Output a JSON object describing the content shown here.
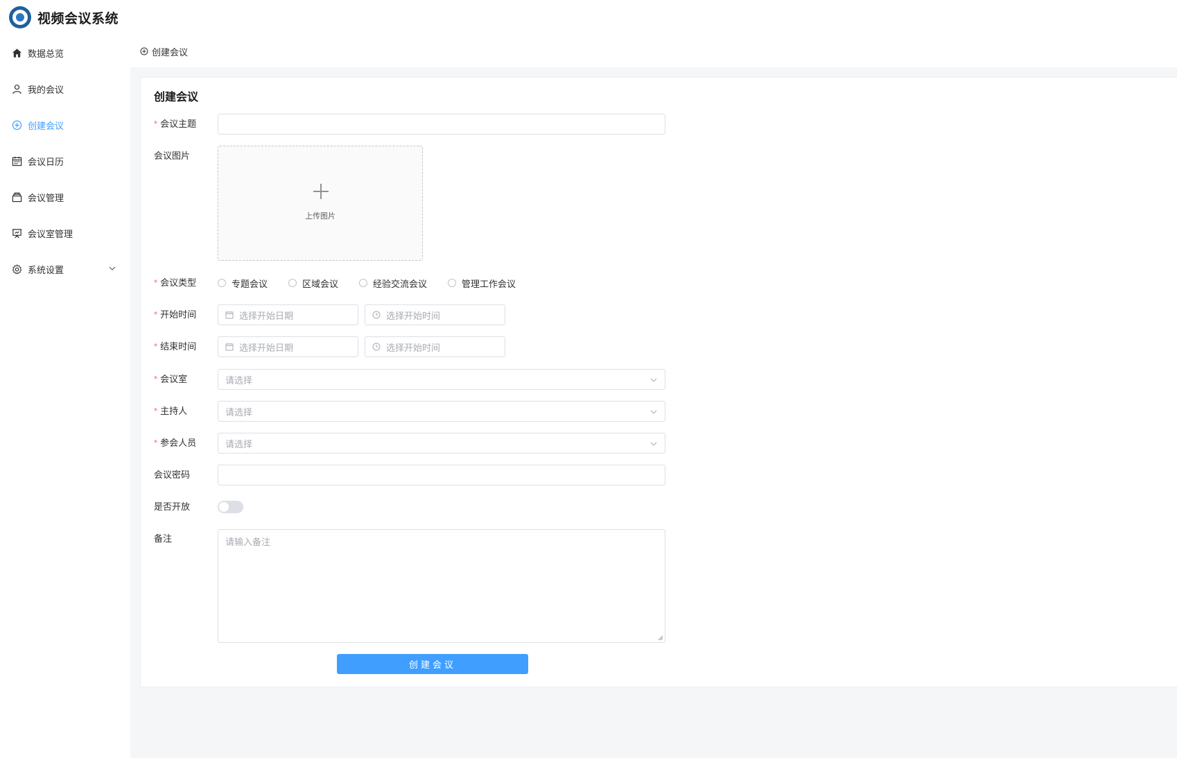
{
  "app": {
    "title": "视频会议系统",
    "logo_icon": "globe-emblem-icon"
  },
  "colors": {
    "accent": "#409eff",
    "required": "#f56c6c",
    "content_bg": "#f5f6f8"
  },
  "sidebar": {
    "items": [
      {
        "label": "数据总览",
        "icon": "home-icon",
        "active": false
      },
      {
        "label": "我的会议",
        "icon": "user-icon",
        "active": false
      },
      {
        "label": "创建会议",
        "icon": "circle-plus-icon",
        "active": true
      },
      {
        "label": "会议日历",
        "icon": "calendar-icon",
        "active": false
      },
      {
        "label": "会议管理",
        "icon": "box-icon",
        "active": false
      },
      {
        "label": "会议室管理",
        "icon": "presentation-icon",
        "active": false
      },
      {
        "label": "系统设置",
        "icon": "gear-icon",
        "active": false,
        "expandable": true
      }
    ]
  },
  "breadcrumb": {
    "label": "创建会议"
  },
  "form": {
    "title": "创建会议",
    "topic": {
      "label": "会议主题",
      "value": ""
    },
    "image": {
      "label": "会议图片",
      "upload_text": "上传图片"
    },
    "type": {
      "label": "会议类型",
      "options": [
        "专题会议",
        "区域会议",
        "经验交流会议",
        "管理工作会议"
      ],
      "selected": null
    },
    "start": {
      "label": "开始时间",
      "date_placeholder": "选择开始日期",
      "time_placeholder": "选择开始时间"
    },
    "end": {
      "label": "结束时间",
      "date_placeholder": "选择开始日期",
      "time_placeholder": "选择开始时间"
    },
    "room": {
      "label": "会议室",
      "placeholder": "请选择"
    },
    "host": {
      "label": "主持人",
      "placeholder": "请选择"
    },
    "participants": {
      "label": "参会人员",
      "placeholder": "请选择"
    },
    "password": {
      "label": "会议密码",
      "value": ""
    },
    "open": {
      "label": "是否开放",
      "value": false
    },
    "remark": {
      "label": "备注",
      "placeholder": "请输入备注"
    },
    "submit_label": "创建会议"
  }
}
